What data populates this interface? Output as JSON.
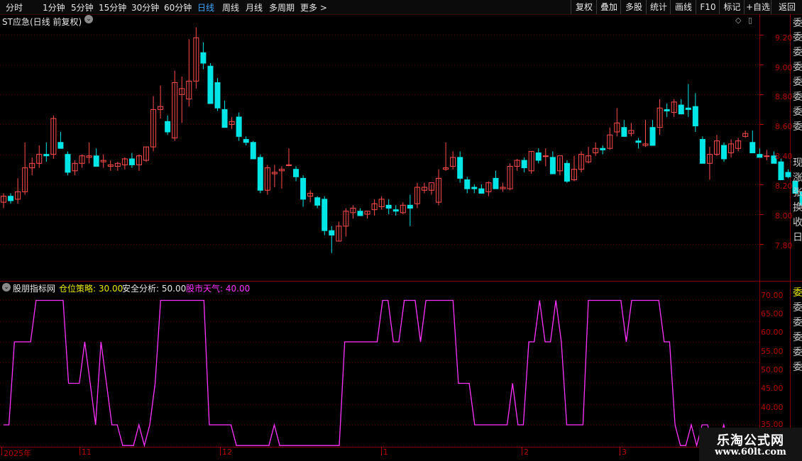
{
  "toolbar": {
    "periods": [
      "分时",
      "1分钟",
      "5分钟",
      "15分钟",
      "30分钟",
      "60分钟",
      "日线",
      "周线",
      "月线",
      "多周期",
      "更多 >"
    ],
    "active_period": "日线",
    "right_buttons": [
      "复权",
      "叠加",
      "多股",
      "统计",
      "画线",
      "F10",
      "标记",
      "+自选",
      "返回"
    ]
  },
  "main_chart": {
    "title": "ST应急(日线 前复权)",
    "y_ticks": [
      "9.20",
      "9.00",
      "8.80",
      "8.60",
      "8.40",
      "8.20",
      "8.00",
      "7.80"
    ],
    "up_color": "#ff4c4c",
    "down_color": "#00e5e5"
  },
  "indicator": {
    "name": "股朋指标网",
    "items": [
      {
        "label": "仓位策略: 30.00",
        "color": "#e8e800"
      },
      {
        "label": "安全分析: 50.00",
        "color": "#e6e6e6"
      },
      {
        "label": "股市天气: 40.00",
        "color": "#ff33ff"
      }
    ],
    "y_ticks": [
      "70.00",
      "65.00",
      "60.00",
      "55.00",
      "50.00",
      "45.00",
      "40.00",
      "35.00"
    ],
    "line_color": "#ff33ff"
  },
  "date_axis": {
    "labels": [
      "2025年",
      "11",
      "12",
      "1",
      "2",
      "3"
    ]
  },
  "right_sidebar_chars": [
    "委",
    "委",
    "委",
    "委",
    "委",
    "委",
    "委",
    "委",
    "现",
    "涨",
    "张",
    "换",
    "收",
    "日",
    "委",
    "委",
    "委",
    "委",
    "委",
    "委"
  ],
  "watermark": {
    "line1": "乐淘公式网",
    "line2": "www.60lt.com"
  },
  "chart_data": [
    {
      "type": "candlestick",
      "title": "ST应急(日线 前复权)",
      "ylim": [
        7.63,
        9.29
      ],
      "candles": [
        [
          8.08,
          8.14,
          8.04,
          8.12
        ],
        [
          8.12,
          8.14,
          8.07,
          8.09
        ],
        [
          8.1,
          8.24,
          8.07,
          8.15
        ],
        [
          8.15,
          8.48,
          8.13,
          8.31
        ],
        [
          8.31,
          8.38,
          8.26,
          8.34
        ],
        [
          8.34,
          8.46,
          8.31,
          8.4
        ],
        [
          8.4,
          8.48,
          8.35,
          8.39
        ],
        [
          8.4,
          8.66,
          8.37,
          8.64
        ],
        [
          8.48,
          8.55,
          8.45,
          8.44
        ],
        [
          8.4,
          8.42,
          8.26,
          8.28
        ],
        [
          8.29,
          8.36,
          8.26,
          8.34
        ],
        [
          8.34,
          8.4,
          8.31,
          8.39
        ],
        [
          8.38,
          8.48,
          8.34,
          8.39
        ],
        [
          8.39,
          8.44,
          8.32,
          8.32
        ],
        [
          8.35,
          8.4,
          8.31,
          8.36
        ],
        [
          8.32,
          8.36,
          8.29,
          8.33
        ],
        [
          8.32,
          8.35,
          8.29,
          8.34
        ],
        [
          8.33,
          8.38,
          8.3,
          8.37
        ],
        [
          8.37,
          8.41,
          8.31,
          8.33
        ],
        [
          8.33,
          8.4,
          8.29,
          8.39
        ],
        [
          8.36,
          8.45,
          8.35,
          8.45
        ],
        [
          8.45,
          8.79,
          8.42,
          8.7
        ],
        [
          8.7,
          8.86,
          8.64,
          8.72
        ],
        [
          8.62,
          8.66,
          8.53,
          8.55
        ],
        [
          8.51,
          8.96,
          8.49,
          8.88
        ],
        [
          8.8,
          8.92,
          8.61,
          8.84
        ],
        [
          8.77,
          9.17,
          8.72,
          8.89
        ],
        [
          8.89,
          9.25,
          8.84,
          9.18
        ],
        [
          9.08,
          9.15,
          8.97,
          9.01
        ],
        [
          8.99,
          9.01,
          8.92,
          8.74
        ],
        [
          8.88,
          8.91,
          8.69,
          8.71
        ],
        [
          8.7,
          8.76,
          8.58,
          8.58
        ],
        [
          8.6,
          8.65,
          8.57,
          8.62
        ],
        [
          8.65,
          8.68,
          8.49,
          8.52
        ],
        [
          8.5,
          8.52,
          8.46,
          8.48
        ],
        [
          8.48,
          8.49,
          8.41,
          8.37
        ],
        [
          8.38,
          8.4,
          8.14,
          8.16
        ],
        [
          8.16,
          8.33,
          8.13,
          8.31
        ],
        [
          8.27,
          8.33,
          8.18,
          8.28
        ],
        [
          8.29,
          8.32,
          8.17,
          8.3
        ],
        [
          8.33,
          8.44,
          8.32,
          8.33
        ],
        [
          8.3,
          8.32,
          8.22,
          8.25
        ],
        [
          8.24,
          8.26,
          8.05,
          8.1
        ],
        [
          8.12,
          8.16,
          8.08,
          8.14
        ],
        [
          8.11,
          8.12,
          8.04,
          8.06
        ],
        [
          8.1,
          8.12,
          7.86,
          7.89
        ],
        [
          7.89,
          7.92,
          7.74,
          7.86
        ],
        [
          7.82,
          7.95,
          7.82,
          7.92
        ],
        [
          7.92,
          8.04,
          7.85,
          8.02
        ],
        [
          8.01,
          8.06,
          7.97,
          8.04
        ],
        [
          8.02,
          8.04,
          8.0,
          7.99
        ],
        [
          8.0,
          8.02,
          7.97,
          8.02
        ],
        [
          8.03,
          8.1,
          7.99,
          8.07
        ],
        [
          8.05,
          8.12,
          8.03,
          8.1
        ],
        [
          8.06,
          8.1,
          8.0,
          8.04
        ],
        [
          8.03,
          8.06,
          7.99,
          8.02
        ],
        [
          8.01,
          8.08,
          8.0,
          8.06
        ],
        [
          8.06,
          8.13,
          7.92,
          8.04
        ],
        [
          8.07,
          8.21,
          8.04,
          8.18
        ],
        [
          8.16,
          8.21,
          8.14,
          8.18
        ],
        [
          8.16,
          8.2,
          8.13,
          8.21
        ],
        [
          8.08,
          8.3,
          8.06,
          8.24
        ],
        [
          8.3,
          8.48,
          8.29,
          8.31
        ],
        [
          8.32,
          8.42,
          8.3,
          8.38
        ],
        [
          8.38,
          8.42,
          8.21,
          8.24
        ],
        [
          8.23,
          8.25,
          8.14,
          8.17
        ],
        [
          8.18,
          8.2,
          8.14,
          8.17
        ],
        [
          8.17,
          8.2,
          8.14,
          8.14
        ],
        [
          8.15,
          8.22,
          8.12,
          8.21
        ],
        [
          8.24,
          8.29,
          8.19,
          8.17
        ],
        [
          8.17,
          8.21,
          8.15,
          8.18
        ],
        [
          8.17,
          8.34,
          8.16,
          8.32
        ],
        [
          8.32,
          8.37,
          8.29,
          8.36
        ],
        [
          8.36,
          8.38,
          8.28,
          8.31
        ],
        [
          8.29,
          8.42,
          8.27,
          8.42
        ],
        [
          8.41,
          8.44,
          8.34,
          8.36
        ],
        [
          8.39,
          8.44,
          8.32,
          8.39
        ],
        [
          8.38,
          8.42,
          8.27,
          8.27
        ],
        [
          8.29,
          8.38,
          8.26,
          8.39
        ],
        [
          8.34,
          8.36,
          8.21,
          8.22
        ],
        [
          8.23,
          8.39,
          8.22,
          8.3
        ],
        [
          8.3,
          8.42,
          8.28,
          8.4
        ],
        [
          8.35,
          8.45,
          8.34,
          8.39
        ],
        [
          8.41,
          8.48,
          8.39,
          8.44
        ],
        [
          8.44,
          8.46,
          8.4,
          8.43
        ],
        [
          8.44,
          8.58,
          8.43,
          8.53
        ],
        [
          8.55,
          8.71,
          8.52,
          8.61
        ],
        [
          8.58,
          8.63,
          8.56,
          8.52
        ],
        [
          8.54,
          8.61,
          8.52,
          8.56
        ],
        [
          8.49,
          8.51,
          8.44,
          8.48
        ],
        [
          8.46,
          8.63,
          8.45,
          8.47
        ],
        [
          8.58,
          8.63,
          8.46,
          8.46
        ],
        [
          8.58,
          8.77,
          8.53,
          8.71
        ],
        [
          8.7,
          8.74,
          8.65,
          8.69
        ],
        [
          8.68,
          8.77,
          8.65,
          8.75
        ],
        [
          8.73,
          8.77,
          8.67,
          8.67
        ],
        [
          8.71,
          8.87,
          8.65,
          8.7
        ],
        [
          8.72,
          8.81,
          8.55,
          8.59
        ],
        [
          8.5,
          8.52,
          8.35,
          8.34
        ],
        [
          8.34,
          8.45,
          8.23,
          8.4
        ],
        [
          8.4,
          8.53,
          8.39,
          8.49
        ],
        [
          8.46,
          8.48,
          8.35,
          8.37
        ],
        [
          8.41,
          8.5,
          8.38,
          8.47
        ],
        [
          8.44,
          8.51,
          8.42,
          8.49
        ],
        [
          8.52,
          8.56,
          8.51,
          8.54
        ],
        [
          8.48,
          8.56,
          8.46,
          8.41
        ],
        [
          8.4,
          8.44,
          8.38,
          8.38
        ],
        [
          8.39,
          8.43,
          8.36,
          8.39
        ],
        [
          8.39,
          8.42,
          8.37,
          8.34
        ],
        [
          8.35,
          8.37,
          8.27,
          8.23
        ],
        [
          8.28,
          8.3,
          8.24,
          8.25
        ],
        [
          8.22,
          8.23,
          8.14,
          8.14
        ],
        [
          8.15,
          8.17,
          8.05,
          8.06
        ],
        [
          7.88,
          7.97,
          7.68,
          7.7
        ],
        [
          7.78,
          8.16,
          7.71,
          8.04
        ]
      ]
    },
    {
      "type": "line",
      "title": "股朋指标网",
      "ylim": [
        34.7,
        72.3
      ],
      "series": [
        {
          "name": "股市天气",
          "values": [
            40,
            40,
            60,
            60,
            60,
            60,
            70,
            70,
            70,
            70,
            70,
            70,
            50,
            50,
            50,
            60,
            50,
            40,
            60,
            50,
            40,
            40,
            35,
            35,
            35,
            40,
            35,
            40,
            50,
            70,
            70,
            70,
            70,
            70,
            70,
            70,
            70,
            70,
            40,
            40,
            40,
            40,
            40,
            35,
            35,
            35,
            35,
            35,
            35,
            35,
            40,
            35,
            35,
            35,
            35,
            35,
            35,
            35,
            35,
            35,
            35,
            35,
            35,
            60,
            60,
            60,
            60,
            60,
            60,
            60,
            70,
            70,
            60,
            60,
            70,
            70,
            70,
            60,
            70,
            70,
            70,
            70,
            70,
            70,
            50,
            50,
            50,
            40,
            40,
            40,
            40,
            40,
            40,
            40,
            50,
            40,
            40,
            60,
            60,
            70,
            60,
            60,
            70,
            60,
            40,
            40,
            40,
            40,
            70,
            70,
            70,
            70,
            70,
            70,
            70,
            60,
            70,
            70,
            70,
            70,
            70,
            70,
            60,
            60,
            40,
            35,
            35,
            40,
            35,
            40,
            40,
            35,
            35,
            40,
            35,
            35
          ]
        }
      ]
    }
  ]
}
